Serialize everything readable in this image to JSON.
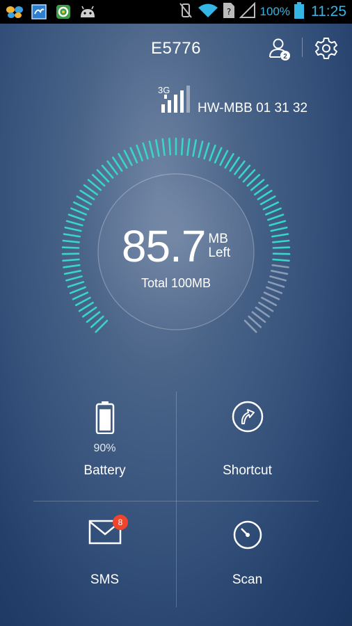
{
  "status_bar": {
    "app_icons": [
      "butterfly-app-icon",
      "photo-app-icon",
      "sync-app-icon",
      "android-icon"
    ],
    "battery_percent": "100%",
    "time": "11:25",
    "accent_color": "#35b5e5"
  },
  "header": {
    "title": "E5776",
    "connected_users": "2"
  },
  "network": {
    "type": "3G",
    "ssid": "HW-MBB 01 31 32",
    "signal_bars": 4
  },
  "data_usage": {
    "remaining": "85.7",
    "unit": "MB",
    "unit_suffix": "Left",
    "total_label": "Total 100MB",
    "remaining_fraction": 0.857,
    "active_color": "#38d6c8"
  },
  "tiles": {
    "battery": {
      "value": "90%",
      "label": "Battery",
      "level": 0.9
    },
    "shortcut": {
      "label": "Shortcut"
    },
    "sms": {
      "label": "SMS",
      "badge": "8",
      "badge_color": "#f0452d"
    },
    "scan": {
      "label": "Scan"
    }
  }
}
